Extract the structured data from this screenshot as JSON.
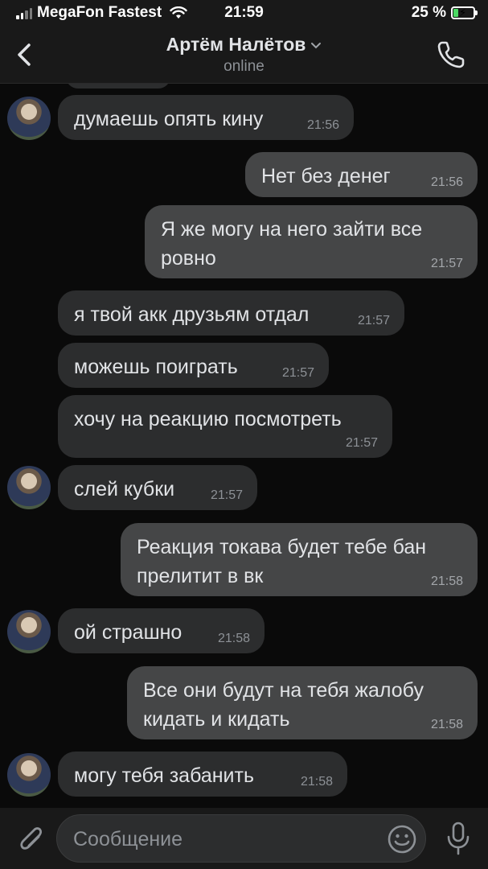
{
  "status_bar": {
    "carrier": "MegaFon Fastest",
    "time": "21:59",
    "battery": "25 %",
    "battery_level": 0.25
  },
  "header": {
    "contact_name": "Артём Налётов",
    "status": "online"
  },
  "messages": [
    {
      "text": "думаешь опять кину",
      "time": "21:56",
      "direction": "in"
    },
    {
      "text": "Нет без денег",
      "time": "21:56",
      "direction": "out"
    },
    {
      "text": "Я же могу на него зайти все ровно",
      "time": "21:57",
      "direction": "out"
    },
    {
      "text": "я твой акк друзьям отдал",
      "time": "21:57",
      "direction": "in"
    },
    {
      "text": "можешь поиграть",
      "time": "21:57",
      "direction": "in"
    },
    {
      "text": "хочу на реакцию посмотреть",
      "time": "21:57",
      "direction": "in"
    },
    {
      "text": "слей кубки",
      "time": "21:57",
      "direction": "in"
    },
    {
      "text": "Реакция токава будет тебе бан прелитит в вк",
      "time": "21:58",
      "direction": "out"
    },
    {
      "text": "ой страшно",
      "time": "21:58",
      "direction": "in"
    },
    {
      "text": "Все они будут на тебя жалобу кидать и кидать",
      "time": "21:58",
      "direction": "out"
    },
    {
      "text": "могу тебя забанить",
      "time": "21:58",
      "direction": "in"
    }
  ],
  "input": {
    "placeholder": "Сообщение"
  },
  "icons": {
    "back": "chevron-left-icon",
    "call": "phone-icon",
    "attach": "paperclip-icon",
    "emoji": "smiley-icon",
    "mic": "microphone-icon"
  },
  "colors": {
    "background": "#0a0a0a",
    "bar": "#191919",
    "incoming_bubble": "#2c2d2e",
    "outgoing_bubble": "#454647",
    "text": "#e1e3e6",
    "secondary_text": "#8d9196",
    "battery": "#4cd964"
  }
}
